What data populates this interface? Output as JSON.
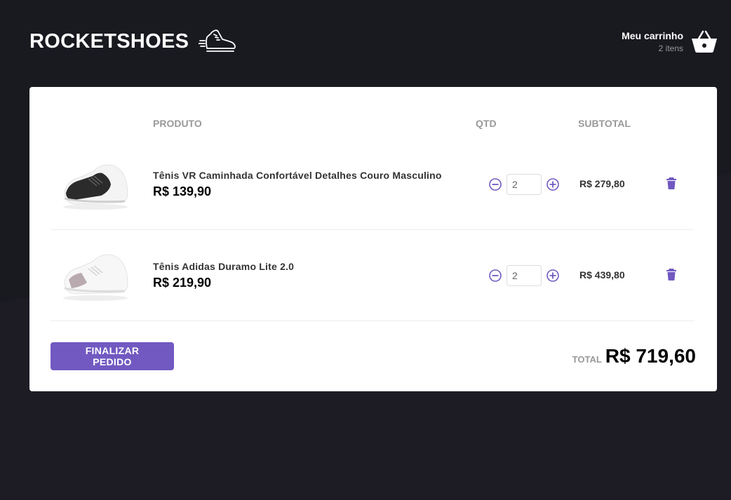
{
  "header": {
    "logo_text": "ROCKETSHOES",
    "cart_title": "Meu carrinho",
    "cart_count": "2 itens"
  },
  "table": {
    "headers": [
      "",
      "PRODUTO",
      "QTD",
      "SUBTOTAL",
      ""
    ],
    "rows": [
      {
        "title": "Tênis VR Caminhada Confortável Detalhes Couro Masculino",
        "price": "R$ 139,90",
        "quantity": "2",
        "subtotal": "R$ 279,80",
        "shoe_color": "black"
      },
      {
        "title": "Tênis Adidas Duramo Lite 2.0",
        "price": "R$ 219,90",
        "quantity": "2",
        "subtotal": "R$ 439,80",
        "shoe_color": "white"
      }
    ]
  },
  "footer": {
    "checkout_label": "Finalizar pedido",
    "total_label": "TOTAL",
    "total_value": "R$ 719,60"
  },
  "colors": {
    "background": "#191920",
    "accent": "#7159c1",
    "panel": "#ffffff"
  },
  "icons": {
    "logo": "running-shoe-icon",
    "cart": "shopping-basket-icon",
    "decrement": "remove-circle-icon",
    "increment": "add-circle-icon",
    "delete": "trash-icon"
  }
}
